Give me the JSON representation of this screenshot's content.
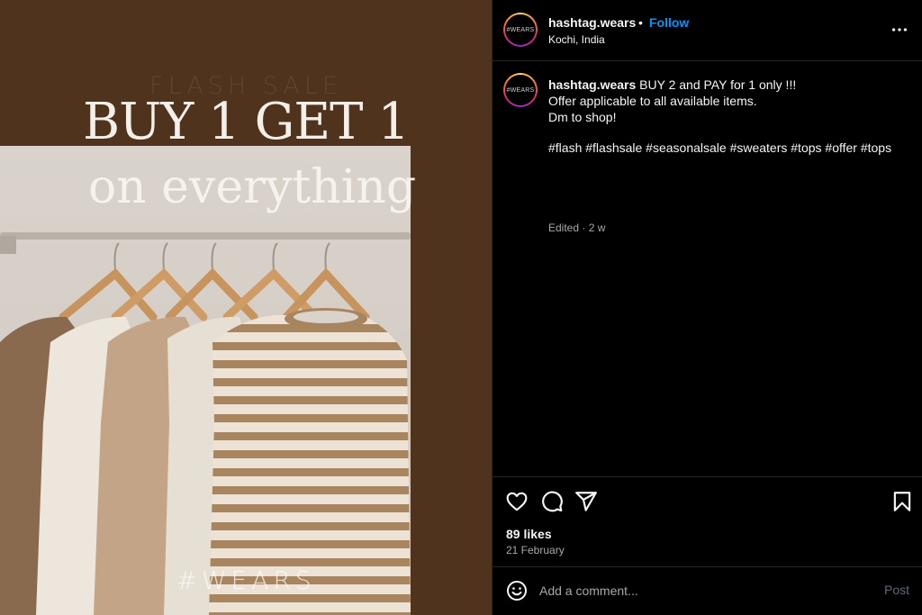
{
  "post_image": {
    "flash_text": "FLASH SALE",
    "headline_line1": "BUY 1 GET 1",
    "headline_line2": "on everything",
    "watermark": "#WEARS"
  },
  "header": {
    "avatar_text": "#WEARS",
    "username": "hashtag.wears",
    "separator": "•",
    "follow_label": "Follow",
    "location": "Kochi, India",
    "more_icon": "more-horizontal-icon"
  },
  "caption": {
    "avatar_text": "#WEARS",
    "username": "hashtag.wears",
    "text": "BUY 2 and PAY for 1 only !!!\nOffer applicable to all available items.\nDm to shop!",
    "hashtags": "#flash #flashsale #seasonalsale #sweaters #tops #offer #tops",
    "edited": "Edited · 2 w"
  },
  "actions": {
    "icons": [
      "heart-icon",
      "comment-icon",
      "share-icon",
      "bookmark-icon"
    ],
    "likes": "89 likes",
    "date": "21 February"
  },
  "comment": {
    "placeholder": "Add a comment...",
    "post_label": "Post"
  },
  "colors": {
    "image_background": "#4f331d",
    "follow": "#0095f6",
    "panel_background": "#000000",
    "muted_text": "#a8a8a8"
  }
}
